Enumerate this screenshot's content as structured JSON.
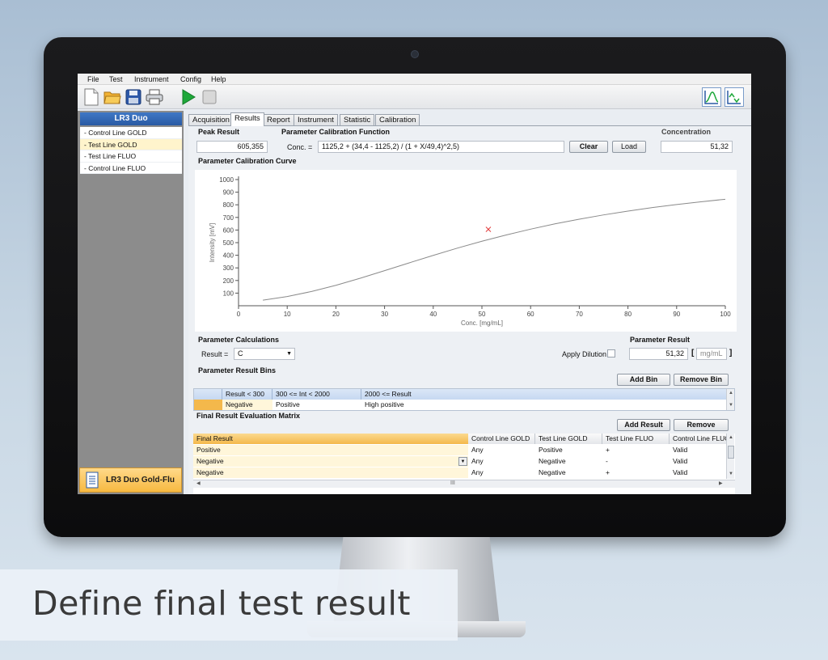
{
  "caption": "Define final test result",
  "menu": [
    "File",
    "Test",
    "Instrument",
    "Config",
    "Help"
  ],
  "toolbar": {
    "icons": [
      "new-document-icon",
      "open-folder-icon",
      "save-disk-icon",
      "print-icon",
      "run-play-icon",
      "stop-icon",
      "calibration-chart-icon",
      "calibration-compare-icon"
    ]
  },
  "sidebar": {
    "title": "LR3 Duo",
    "items": [
      "- Control Line GOLD",
      "- Test Line GOLD",
      "- Test Line FLUO",
      "- Control Line FLUO"
    ],
    "selected_index": 1,
    "bottom_label": "LR3 Duo Gold-Flu"
  },
  "tabs": [
    "Acquisition",
    "Results",
    "Report",
    "Instrument",
    "Statistic",
    "Calibration"
  ],
  "active_tab": "Results",
  "results": {
    "peak_result_label": "Peak Result",
    "peak_result_value": "605,355",
    "function_label": "Parameter Calibration Function",
    "conc_prefix": "Conc. =",
    "function_value": "1125,2 + (34,4  - 1125,2) / (1 + X/49,4)^2,5)",
    "clear_label": "Clear",
    "load_label": "Load",
    "concentration_label": "Concentration",
    "concentration_value": "51,32",
    "curve_label": "Parameter Calibration Curve"
  },
  "chart_data": {
    "type": "line",
    "title": "",
    "xlabel": "Conc. [mg/mL]",
    "ylabel": "Intensity [mV]",
    "xlim": [
      0,
      100
    ],
    "ylim": [
      0,
      1000
    ],
    "xticks": [
      0,
      10,
      20,
      30,
      40,
      50,
      60,
      70,
      80,
      90,
      100
    ],
    "yticks": [
      100,
      200,
      300,
      400,
      500,
      600,
      700,
      800,
      900,
      1000
    ],
    "series": [
      {
        "x": [
          5,
          10,
          15,
          20,
          25,
          30,
          35,
          40,
          45,
          50,
          55,
          60,
          65,
          70,
          75,
          80,
          85,
          90,
          95,
          100
        ],
        "values": [
          44,
          73,
          113,
          162,
          218,
          278,
          339,
          399,
          457,
          511,
          561,
          607,
          649,
          686,
          720,
          750,
          778,
          802,
          824,
          844
        ]
      }
    ],
    "marker": {
      "x": 51.32,
      "y": 605.355,
      "symbol": "x",
      "color": "#e03030"
    },
    "line_color": "#8a8a8a",
    "grid": false
  },
  "calc": {
    "label": "Parameter Calculations",
    "result_label": "Result =",
    "result_select": "C",
    "apply_dilution_label": "Apply Dilution",
    "param_result_label": "Parameter Result",
    "param_result_value": "51,32",
    "unit_prefix": "[",
    "unit_placeholder": "mg/mL",
    "unit_suffix": "]"
  },
  "bins": {
    "label": "Parameter Result Bins",
    "add_label": "Add Bin",
    "remove_label": "Remove Bin",
    "headers": [
      "Result < 300",
      "300 <= Int < 2000",
      "2000 <= Result"
    ],
    "row": [
      "Negative",
      "Positive",
      "High positive"
    ]
  },
  "matrix": {
    "label": "Final Result Evaluation Matrix",
    "add_label": "Add Result",
    "remove_label": "Remove",
    "headers": [
      "Final Result",
      "Control Line GOLD",
      "Test Line GOLD",
      "Test Line FLUO",
      "Control Line FLUO"
    ],
    "rows": [
      [
        "Positive",
        "Any",
        "Positive",
        "+",
        "Valid"
      ],
      [
        "Negative",
        "Any",
        "Negative",
        "-",
        "Valid"
      ],
      [
        "Negative",
        "Any",
        "Negative",
        "+",
        "Valid"
      ]
    ],
    "scroll_mark": "III"
  },
  "colors": {
    "accent_blue": "#2a5aa3",
    "highlight_yellow": "#fff6da",
    "header_orange": "#f4b84b",
    "play_green": "#1ea83a"
  }
}
